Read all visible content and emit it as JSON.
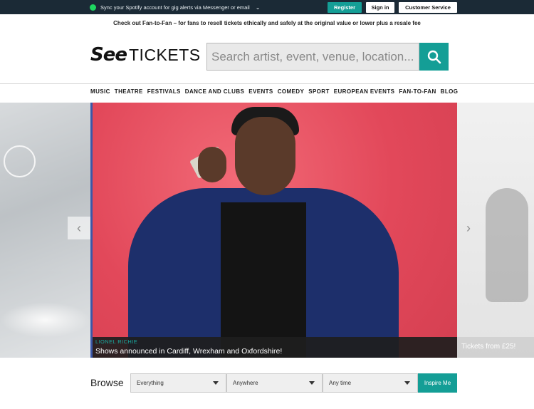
{
  "topbar": {
    "spotify_text": "Sync your Spotify account for gig alerts via Messenger or email",
    "register_label": "Register",
    "signin_label": "Sign in",
    "customer_service_label": "Customer Service"
  },
  "promo": {
    "text": "Check out Fan-to-Fan – for fans to resell tickets ethically and safely at the original value or lower plus a resale fee"
  },
  "logo": {
    "see": "See",
    "tickets": "TICKETS"
  },
  "search": {
    "placeholder": "Search artist, event, venue, location..."
  },
  "nav": {
    "items": [
      "MUSIC",
      "THEATRE",
      "FESTIVALS",
      "DANCE AND CLUBS",
      "EVENTS",
      "COMEDY",
      "SPORT",
      "EUROPEAN EVENTS",
      "FAN-TO-FAN",
      "BLOG"
    ]
  },
  "hero": {
    "kicker": "LIONEL RICHIE",
    "title": "Shows announced in Cardiff, Wrexham and Oxfordshire!",
    "next_caption": "Tickets from £25!"
  },
  "browse": {
    "label": "Browse",
    "what": "Everything",
    "where": "Anywhere",
    "when": "Any time",
    "inspire_label": "Inspire Me"
  },
  "colors": {
    "accent": "#149e96",
    "topbar": "#1b2a36",
    "spotify": "#1ed760"
  }
}
